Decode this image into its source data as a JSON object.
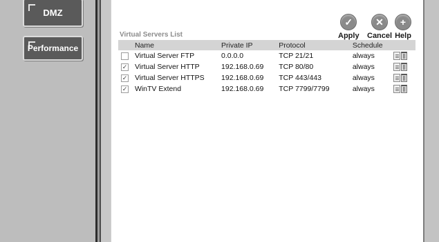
{
  "nav": {
    "dmz_label": "DMZ",
    "performance_label": "Performance"
  },
  "toolbar": {
    "apply_label": "Apply",
    "cancel_label": "Cancel",
    "help_label": "Help",
    "apply_icon": "check-icon",
    "cancel_icon": "x-icon",
    "help_icon": "plus-icon"
  },
  "list": {
    "title": "Virtual Servers List",
    "columns": {
      "name": "Name",
      "private_ip": "Private IP",
      "protocol": "Protocol",
      "schedule": "Schedule"
    },
    "rows": [
      {
        "checked": false,
        "name": "Virtual Server FTP",
        "private_ip": "0.0.0.0",
        "protocol": "TCP 21/21",
        "schedule": "always"
      },
      {
        "checked": true,
        "name": "Virtual Server HTTP",
        "private_ip": "192.168.0.69",
        "protocol": "TCP 80/80",
        "schedule": "always"
      },
      {
        "checked": true,
        "name": "Virtual Server HTTPS",
        "private_ip": "192.168.0.69",
        "protocol": "TCP 443/443",
        "schedule": "always"
      },
      {
        "checked": true,
        "name": "WinTV Extend",
        "private_ip": "192.168.0.69",
        "protocol": "TCP 7799/7799",
        "schedule": "always"
      }
    ]
  }
}
